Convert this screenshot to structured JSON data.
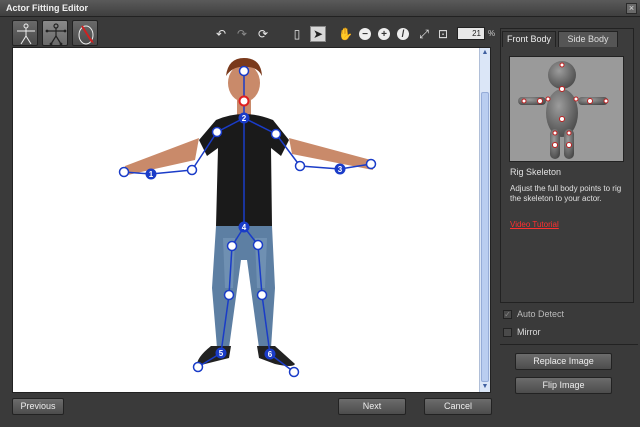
{
  "window": {
    "title": "Actor Fitting Editor",
    "close_glyph": "×"
  },
  "toolbar": {
    "modes": [
      {
        "name": "body-mode-button",
        "icon": "stick-figure-icon"
      },
      {
        "name": "skeleton-mode-button",
        "icon": "skeleton-figure-icon"
      },
      {
        "name": "brush-mode-button",
        "icon": "brush-figure-icon"
      }
    ],
    "tools": [
      {
        "name": "undo-button",
        "icon": "undo-icon",
        "glyph": "↶"
      },
      {
        "name": "redo-button",
        "icon": "redo-icon",
        "glyph": "↷"
      },
      {
        "name": "reset-button",
        "icon": "refresh-icon",
        "glyph": "⟳"
      },
      {
        "name": "panel-toggle-button",
        "icon": "panel-icon",
        "glyph": "▯"
      },
      {
        "name": "select-tool-button",
        "icon": "cursor-icon",
        "glyph": "➤"
      },
      {
        "name": "pan-tool-button",
        "icon": "hand-icon",
        "glyph": "✋"
      },
      {
        "name": "zoom-out-button",
        "icon": "minus-icon",
        "glyph": "−"
      },
      {
        "name": "zoom-in-button",
        "icon": "plus-icon",
        "glyph": "+"
      },
      {
        "name": "no-zoom-button",
        "icon": "slash-icon",
        "glyph": "/"
      },
      {
        "name": "fit-button",
        "icon": "fit-icon",
        "glyph": "⤢"
      },
      {
        "name": "zoom-window-button",
        "icon": "zoom-window-icon",
        "glyph": "⊡"
      }
    ],
    "zoom_value": "21",
    "zoom_unit": "%"
  },
  "skeleton_labels": [
    "1",
    "2",
    "3",
    "4",
    "5",
    "6"
  ],
  "tabs": {
    "front": "Front Body",
    "side": "Side Body"
  },
  "panel": {
    "heading": "Rig Skeleton",
    "description": "Adjust the full body points to rig the skeleton to your actor.",
    "link": "Video Tutorial"
  },
  "options": {
    "auto_detect": "Auto Detect",
    "mirror": "Mirror",
    "check_glyph": "✓"
  },
  "buttons": {
    "replace": "Replace Image",
    "flip": "Flip Image",
    "previous": "Previous",
    "next": "Next",
    "cancel": "Cancel"
  },
  "colors": {
    "skeleton": "#1a3cc8",
    "joint_highlight": "#e02020",
    "link": "#ff3030"
  }
}
